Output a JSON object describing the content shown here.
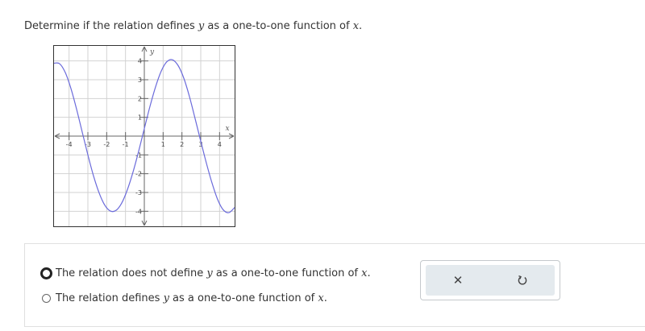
{
  "question": {
    "part1": "Determine if the relation defines ",
    "var_y": "y",
    "part2": " as a one-to-one function of ",
    "var_x": "x",
    "part3": "."
  },
  "chart_data": {
    "type": "line",
    "xlabel": "x",
    "ylabel": "y",
    "xlim": [
      -4.8,
      4.8
    ],
    "ylim": [
      -4.8,
      4.8
    ],
    "grid": true,
    "x_ticks": [
      -4,
      -3,
      -2,
      -1,
      1,
      2,
      3,
      4
    ],
    "y_ticks": [
      -4,
      -3,
      -2,
      -1,
      1,
      2,
      3,
      4
    ],
    "x_tick_labels": [
      "-4",
      "-3",
      "-2",
      "-1",
      "1",
      "2",
      "3",
      "4"
    ],
    "y_tick_labels": [
      "-4",
      "-3",
      "-2",
      "-1",
      "1",
      "2",
      "3",
      "4"
    ],
    "series": [
      {
        "color": "#6b6bdb",
        "x": [
          -4.8,
          -4.5,
          -4.2,
          -3.9,
          -3.6,
          -3.3,
          -3.0,
          -2.7,
          -2.4,
          -2.1,
          -1.8,
          -1.5,
          -1.2,
          -0.9,
          -0.6,
          -0.3,
          0.0,
          0.3,
          0.6,
          0.9,
          1.2,
          1.5,
          1.8,
          2.1,
          2.4,
          2.7,
          3.0,
          3.3,
          3.6,
          3.9,
          4.2,
          4.5,
          4.8
        ],
        "y": [
          3.88,
          3.85,
          3.38,
          2.53,
          1.43,
          0.21,
          -1.0,
          -2.12,
          -3.03,
          -3.68,
          -3.99,
          -3.95,
          -3.56,
          -2.85,
          -1.91,
          -0.8,
          0.4,
          1.58,
          2.63,
          3.46,
          3.96,
          4.06,
          3.75,
          3.08,
          2.1,
          0.93,
          -0.27,
          -1.44,
          -2.5,
          -3.38,
          -3.93,
          -4.07,
          -3.8
        ]
      }
    ]
  },
  "choices": [
    {
      "part1": "The relation does not define ",
      "var_y": "y",
      "part2": " as a one-to-one function of ",
      "var_x": "x",
      "part3": "."
    },
    {
      "part1": "The relation defines ",
      "var_y": "y",
      "part2": " as a one-to-one function of ",
      "var_x": "x",
      "part3": "."
    }
  ],
  "buttons": {
    "clear_icon": "close-icon",
    "clear_glyph": "✕",
    "reset_icon": "undo-icon"
  },
  "colors": {
    "curve": "#6b6bdb",
    "button_bg": "#e4eaee"
  }
}
